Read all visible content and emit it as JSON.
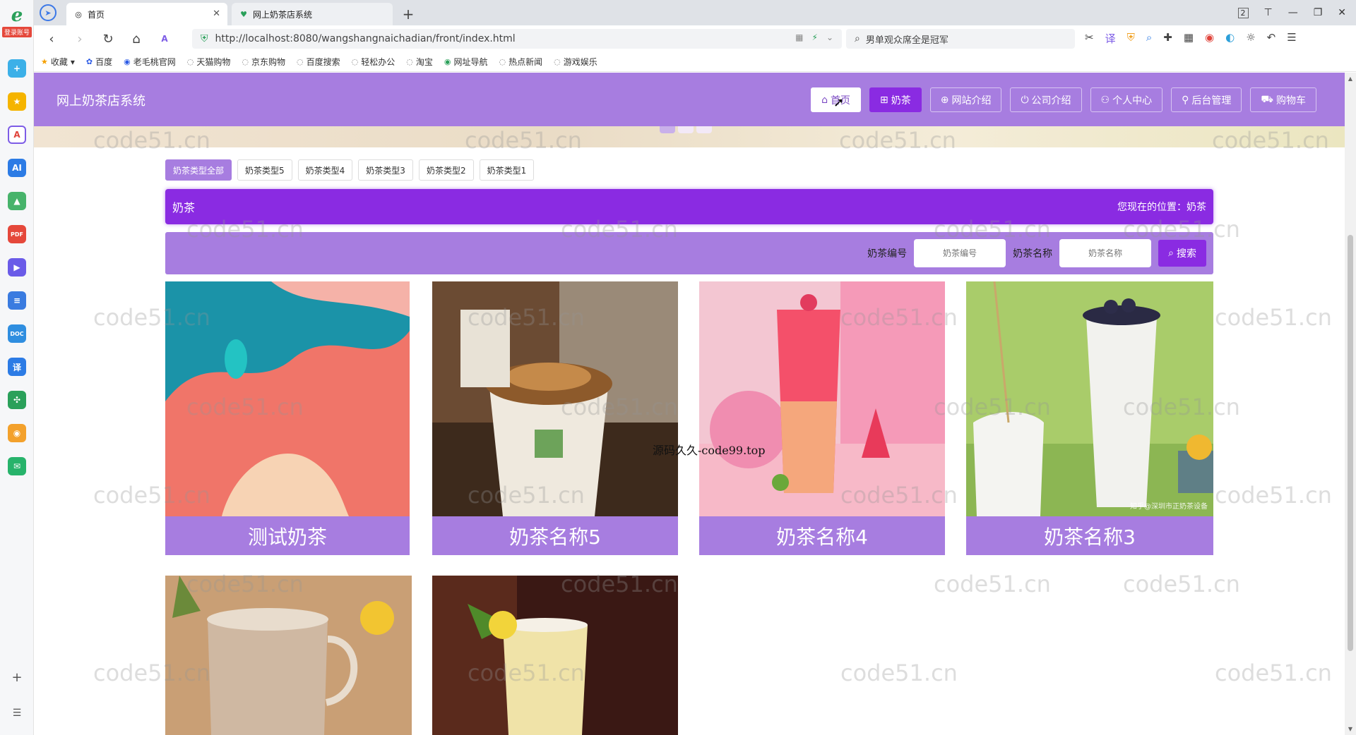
{
  "browser": {
    "tabs": [
      {
        "title": "首页",
        "active": true
      },
      {
        "title": "网上奶茶店系统",
        "active": false
      }
    ],
    "url": "http://localhost:8080/wangshangnaichadian/front/index.html",
    "search_text": "男单观众席全是冠军",
    "tab_count": "2",
    "bookmarks": [
      "收藏",
      "百度",
      "老毛桃官网",
      "天猫购物",
      "京东购物",
      "百度搜索",
      "轻松办公",
      "淘宝",
      "网址导航",
      "热点新闻",
      "游戏娱乐"
    ],
    "sidebar_badge": "登录账号"
  },
  "header": {
    "brand": "网上奶茶店系统",
    "menu": [
      {
        "label": "首页",
        "icon": "home-icon"
      },
      {
        "label": "奶茶",
        "icon": "grid-icon"
      },
      {
        "label": "网站介绍",
        "icon": "globe-icon"
      },
      {
        "label": "公司介绍",
        "icon": "power-icon"
      },
      {
        "label": "个人中心",
        "icon": "user-icon"
      },
      {
        "label": "后台管理",
        "icon": "link-icon"
      },
      {
        "label": "购物车",
        "icon": "cart-icon"
      }
    ]
  },
  "type_tabs": [
    "奶茶类型全部",
    "奶茶类型5",
    "奶茶类型4",
    "奶茶类型3",
    "奶茶类型2",
    "奶茶类型1"
  ],
  "position_bar": {
    "title": "奶茶",
    "location": "您现在的位置：奶茶"
  },
  "filter": {
    "label_code": "奶茶编号",
    "placeholder_code": "奶茶编号",
    "label_name": "奶茶名称",
    "placeholder_name": "奶茶名称",
    "search_label": "搜索"
  },
  "products": [
    {
      "name": "测试奶茶"
    },
    {
      "name": "奶茶名称5"
    },
    {
      "name": "奶茶名称4"
    },
    {
      "name": "奶茶名称3"
    }
  ],
  "watermark": {
    "text": "code51.cn",
    "center_text": "源码久久-code99.top",
    "photo_caption": "知乎@深圳市正奶茶设备"
  },
  "colors": {
    "header": "#a77de0",
    "accent": "#8a2be2"
  }
}
